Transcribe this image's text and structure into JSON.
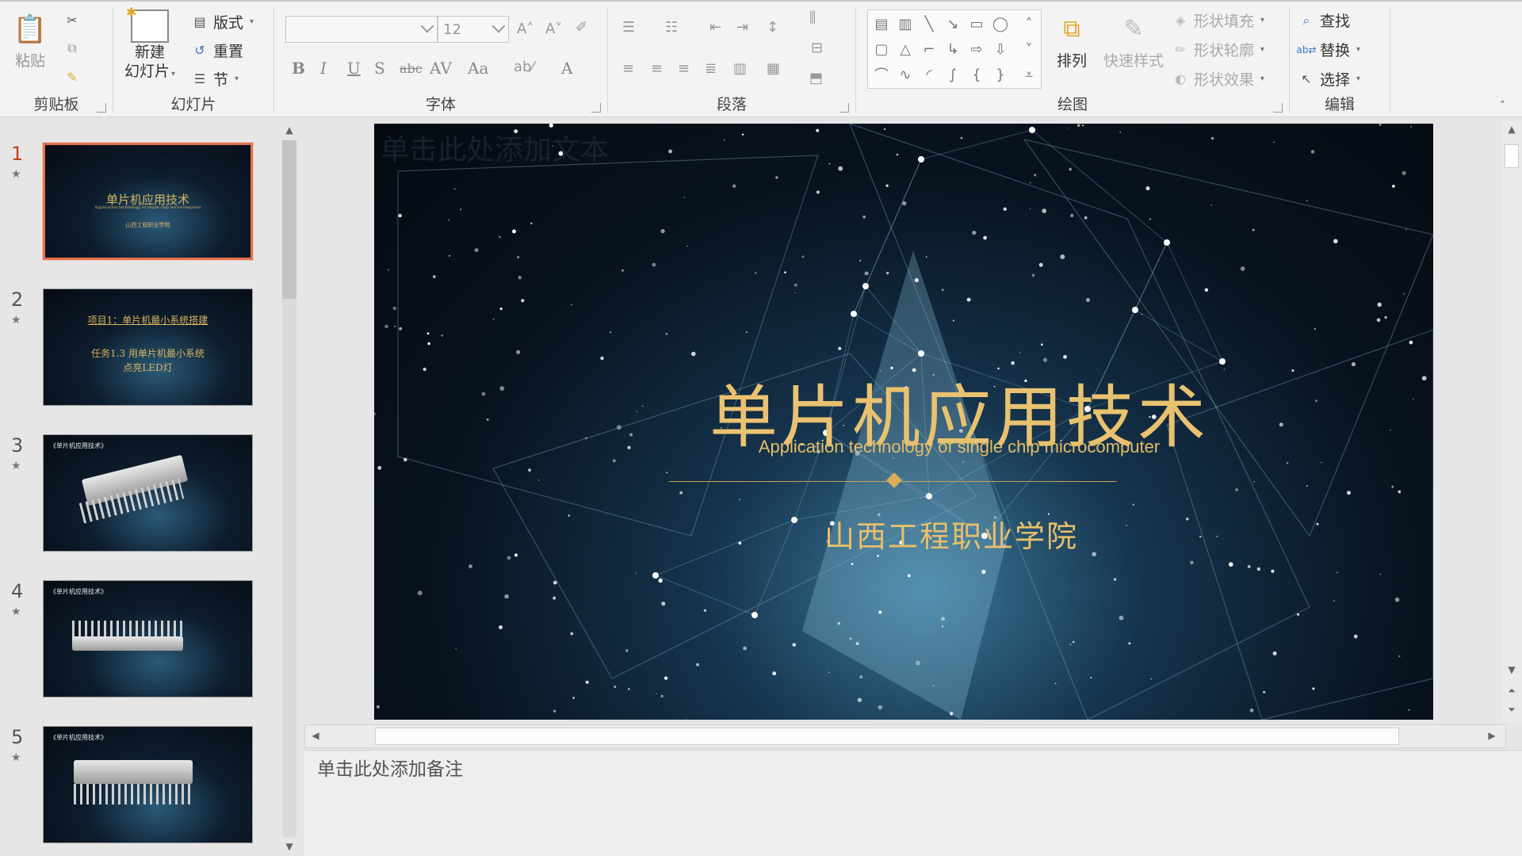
{
  "ribbon": {
    "clipboard": {
      "paste": "粘贴",
      "label": "剪贴板"
    },
    "slides": {
      "new_slide_line1": "新建",
      "new_slide_line2": "幻灯片",
      "layout": "版式",
      "reset": "重置",
      "section": "节",
      "label": "幻灯片"
    },
    "font": {
      "size": "12",
      "label": "字体",
      "buttons": [
        "B",
        "I",
        "U",
        "S",
        "abc",
        "AV",
        "Aa",
        "A"
      ]
    },
    "paragraph": {
      "label": "段落"
    },
    "drawing": {
      "arrange": "排列",
      "quick_styles": "快速样式",
      "shape_fill": "形状填充",
      "shape_outline": "形状轮廓",
      "shape_effects": "形状效果",
      "label": "绘图"
    },
    "editing": {
      "find": "查找",
      "replace": "替换",
      "select": "选择",
      "label": "编辑"
    }
  },
  "thumbnails": [
    {
      "number": "1",
      "title": "单片机应用技术",
      "subtitle": "Application technology of single chip microcomputer",
      "inst": "山西工程职业学院",
      "selected": true
    },
    {
      "number": "2",
      "line1": "项目1：单片机最小系统搭建",
      "line2": "任务1.3 用单片机最小系统",
      "line3": "点亮LED灯"
    },
    {
      "number": "3",
      "tag": "《单片机应用技术》"
    },
    {
      "number": "4",
      "tag": "《单片机应用技术》"
    },
    {
      "number": "5",
      "tag": "《单片机应用技术》"
    }
  ],
  "slide": {
    "placeholder": "单击此处添加文本",
    "title": "单片机应用技术",
    "subtitle": "Application technology of single chip microcomputer",
    "institution": "山西工程职业学院"
  },
  "notes": {
    "placeholder": "单击此处添加备注"
  },
  "colors": {
    "accent": "#c43e1c",
    "gold": "#e9c270",
    "slide_bg": "#08131f"
  }
}
